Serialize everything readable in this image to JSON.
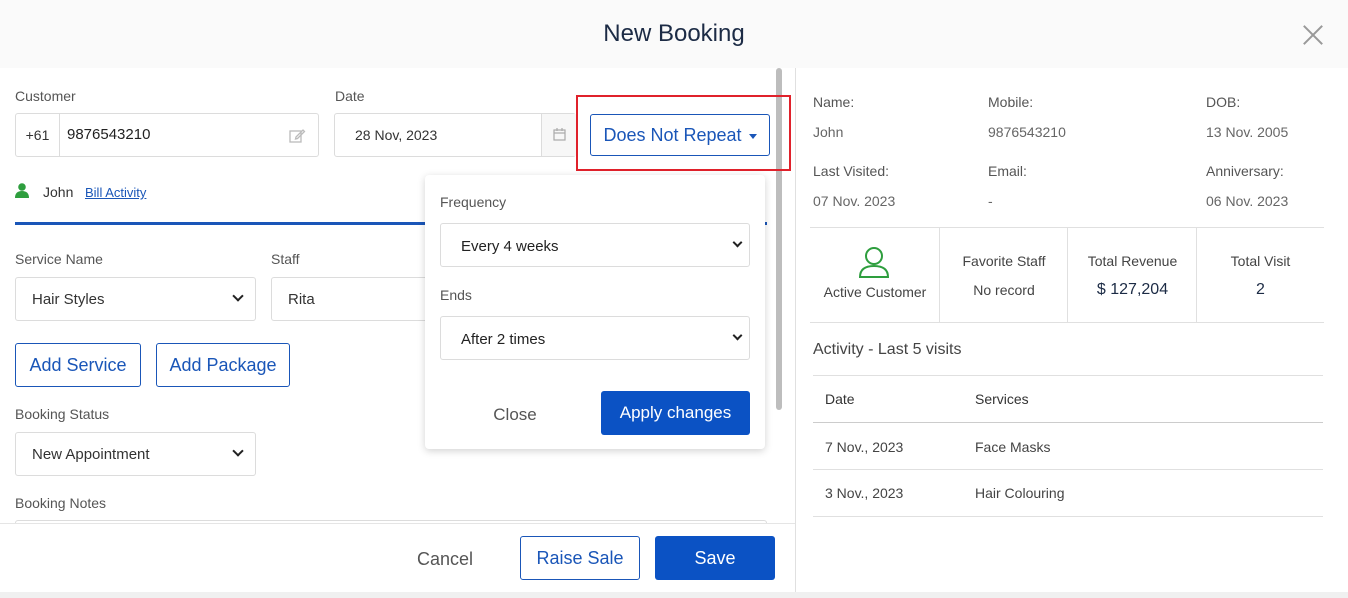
{
  "modal": {
    "title": "New Booking"
  },
  "customer": {
    "label": "Customer",
    "country_code": "+61",
    "phone": "9876543210",
    "name": "John",
    "bill_activity": "Bill Activity"
  },
  "date": {
    "label": "Date",
    "value": "28 Nov, 2023"
  },
  "repeat": {
    "label": "Does Not Repeat"
  },
  "service": {
    "service_label": "Service Name",
    "service_value": "Hair Styles",
    "staff_label": "Staff",
    "staff_value": "Rita",
    "add_service": "Add Service",
    "add_package": "Add Package"
  },
  "booking": {
    "status_label": "Booking Status",
    "status_value": "New Appointment",
    "notes_label": "Booking Notes"
  },
  "popup": {
    "frequency_label": "Frequency",
    "frequency_value": "Every 4 weeks",
    "ends_label": "Ends",
    "ends_value": "After 2 times",
    "close": "Close",
    "apply": "Apply changes"
  },
  "footer": {
    "cancel": "Cancel",
    "raise_sale": "Raise Sale",
    "save": "Save"
  },
  "details": {
    "name_label": "Name:",
    "name_value": "John",
    "mobile_label": "Mobile:",
    "mobile_value": "9876543210",
    "dob_label": "DOB:",
    "dob_value": "13 Nov. 2005",
    "last_visited_label": "Last Visited:",
    "last_visited_value": "07 Nov. 2023",
    "email_label": "Email:",
    "email_value": "-",
    "anniversary_label": "Anniversary:",
    "anniversary_value": "06 Nov. 2023"
  },
  "stats": {
    "active_customer": "Active Customer",
    "favorite_staff_label": "Favorite Staff",
    "favorite_staff_value": "No record",
    "total_revenue_label": "Total Revenue",
    "total_revenue_value": "$ 127,204",
    "total_visit_label": "Total Visit",
    "total_visit_value": "2"
  },
  "activity": {
    "title": "Activity - Last 5 visits",
    "col_date": "Date",
    "col_services": "Services",
    "rows": [
      {
        "date": "7 Nov., 2023",
        "service": "Face Masks"
      },
      {
        "date": "3 Nov., 2023",
        "service": "Hair Colouring"
      }
    ]
  },
  "colors": {
    "accent": "#0b52c4",
    "highlight": "#e0212b",
    "success": "#2e9e3e"
  }
}
